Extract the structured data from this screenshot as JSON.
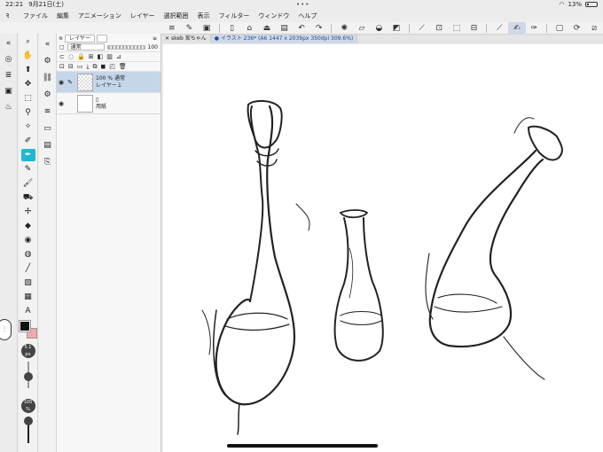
{
  "status": {
    "time": "22:21",
    "date": "9月21日(土)",
    "battery": "13%"
  },
  "menu": [
    "ファイル",
    "編集",
    "アニメーション",
    "レイヤー",
    "選択範囲",
    "表示",
    "フィルター",
    "ウィンドウ",
    "ヘルプ"
  ],
  "layer_panel": {
    "tab": "レイヤー",
    "blend_mode": "通常",
    "opacity": "100",
    "layers": [
      {
        "opacity_mode": "100 % 通常",
        "name": "レイヤー１"
      },
      {
        "name": "用紙"
      }
    ]
  },
  "tabs": {
    "doc1": "skeb 宮ちゃん",
    "doc2": "イラスト 236* (A6 1447 x 2039px 350dpi 309.6%)"
  },
  "brush": {
    "size": "5.1",
    "opacity": "100"
  },
  "colors": {
    "main": "#111111",
    "sub": "#f5a9a9",
    "accent": "#1fb7d4"
  }
}
